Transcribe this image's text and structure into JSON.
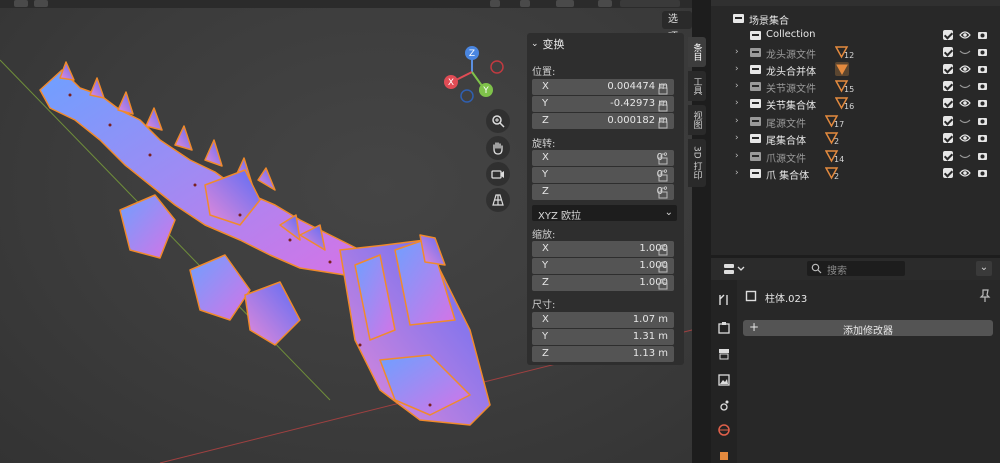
{
  "viewport": {
    "options_label": "选项",
    "gizmo": {
      "x": "X",
      "y": "Y",
      "z": "Z"
    }
  },
  "npanel": {
    "section_title": "变换",
    "location_label": "位置:",
    "location": [
      {
        "axis": "X",
        "value": "0.004474 m"
      },
      {
        "axis": "Y",
        "value": "-0.42973 m"
      },
      {
        "axis": "Z",
        "value": "0.000182 m"
      }
    ],
    "rotation_label": "旋转:",
    "rotation": [
      {
        "axis": "X",
        "value": "0°"
      },
      {
        "axis": "Y",
        "value": "0°"
      },
      {
        "axis": "Z",
        "value": "0°"
      }
    ],
    "rotation_mode": "XYZ 欧拉",
    "scale_label": "缩放:",
    "scale": [
      {
        "axis": "X",
        "value": "1.000"
      },
      {
        "axis": "Y",
        "value": "1.000"
      },
      {
        "axis": "Z",
        "value": "1.000"
      }
    ],
    "dimensions_label": "尺寸:",
    "dimensions": [
      {
        "axis": "X",
        "value": "1.07 m"
      },
      {
        "axis": "Y",
        "value": "1.31 m"
      },
      {
        "axis": "Z",
        "value": "1.13 m"
      }
    ]
  },
  "sidebar_tabs": [
    "条目",
    "工具",
    "视图",
    "3D 打印"
  ],
  "outliner": {
    "scene_collection": "场景集合",
    "rows": [
      {
        "label": "Collection",
        "dim": false,
        "has_arrow": false,
        "badge": ""
      },
      {
        "label": "龙头源文件",
        "dim": true,
        "has_arrow": true,
        "badge": "12"
      },
      {
        "label": "龙头合并体",
        "dim": false,
        "has_arrow": true,
        "badge": ""
      },
      {
        "label": "关节源文件",
        "dim": true,
        "has_arrow": true,
        "badge": "15"
      },
      {
        "label": "关节集合体",
        "dim": false,
        "has_arrow": true,
        "badge": "16"
      },
      {
        "label": "尾源文件",
        "dim": true,
        "has_arrow": true,
        "badge": "17"
      },
      {
        "label": "尾集合体",
        "dim": false,
        "has_arrow": true,
        "badge": "2"
      },
      {
        "label": "爪源文件",
        "dim": true,
        "has_arrow": true,
        "badge": "14"
      },
      {
        "label": "爪 集合体",
        "dim": false,
        "has_arrow": true,
        "badge": "2"
      }
    ]
  },
  "properties": {
    "search_placeholder": "搜索",
    "object_name": "柱体.023",
    "add_modifier_label": "添加修改器"
  },
  "colors": {
    "accent": "#4772b3",
    "selection_outline": "#f0852a",
    "mesh_blue": "#5a7bf0",
    "mesh_pink": "#d774e8"
  }
}
